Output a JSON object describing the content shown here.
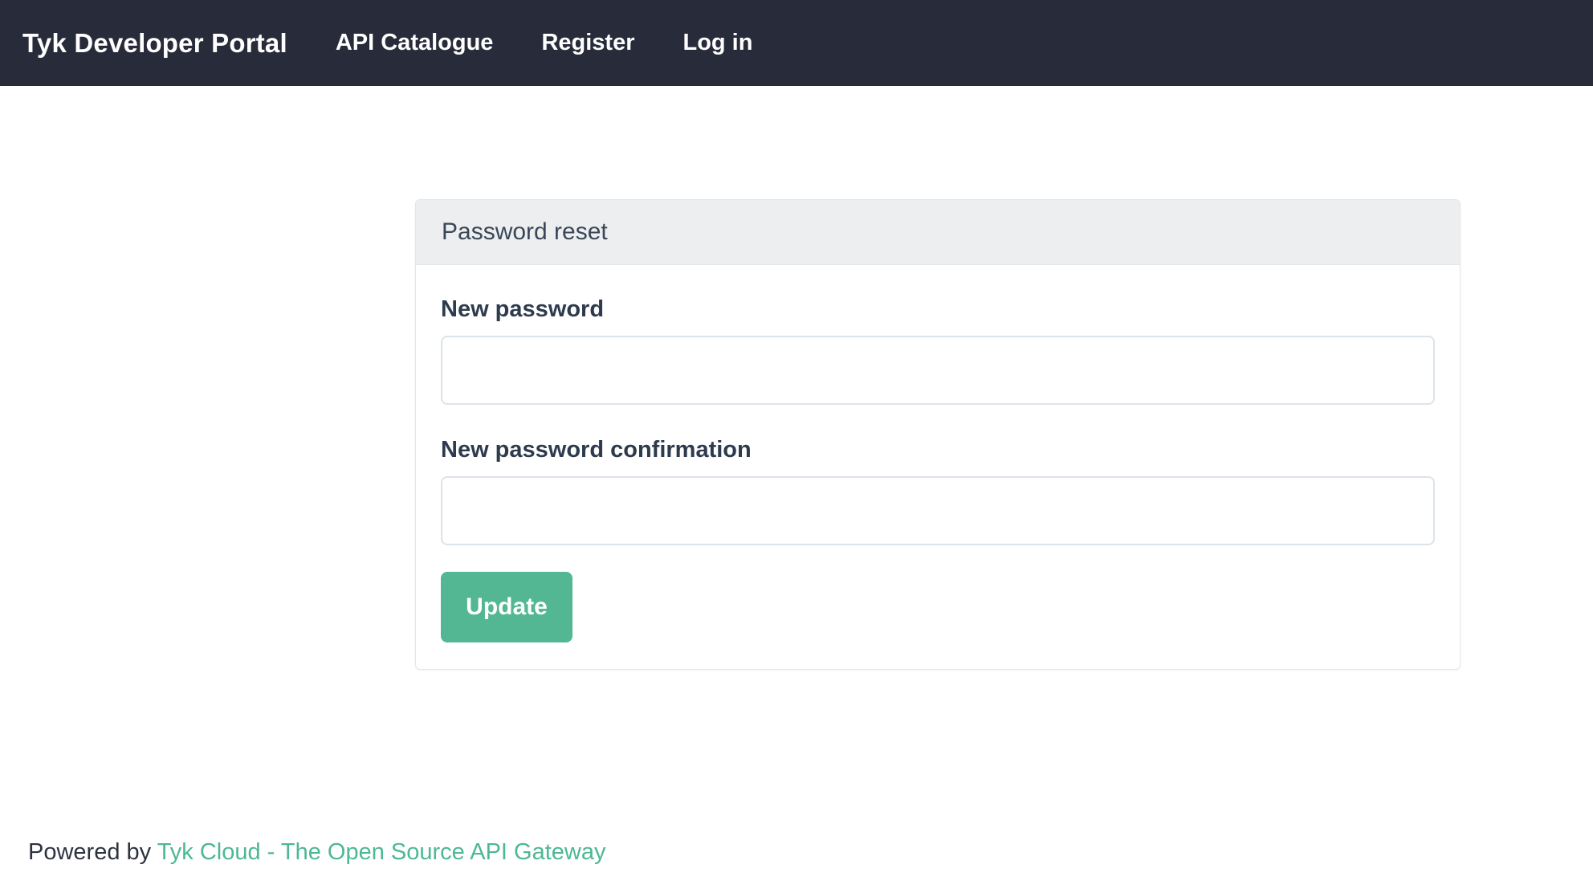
{
  "navbar": {
    "brand": "Tyk Developer Portal",
    "links": [
      {
        "label": "API Catalogue"
      },
      {
        "label": "Register"
      },
      {
        "label": "Log in"
      }
    ]
  },
  "card": {
    "title": "Password reset",
    "form": {
      "fields": [
        {
          "label": "New password",
          "value": "",
          "type": "password"
        },
        {
          "label": "New password confirmation",
          "value": "",
          "type": "password"
        }
      ],
      "submit_label": "Update"
    }
  },
  "footer": {
    "prefix": "Powered by ",
    "link_text": "Tyk Cloud - The Open Source API Gateway"
  },
  "colors": {
    "navbar_bg": "#282b3a",
    "panel_header_bg": "#eceef0",
    "accent_green": "#53b793",
    "link_green": "#4db893",
    "input_border": "#dce3ea"
  }
}
